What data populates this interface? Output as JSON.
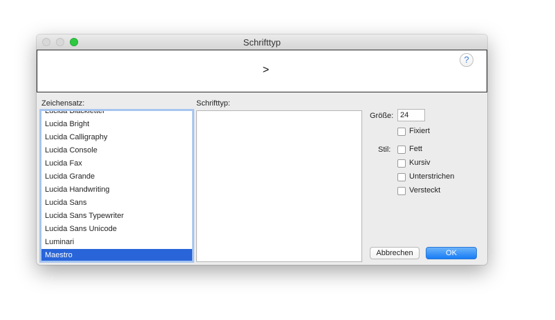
{
  "window": {
    "title": "Schrifttyp"
  },
  "preview": {
    "sample_text": ">",
    "help_label": "?"
  },
  "charset": {
    "label": "Zeichensatz:",
    "items": [
      "Lucida Blackletter",
      "Lucida Bright",
      "Lucida Calligraphy",
      "Lucida Console",
      "Lucida Fax",
      "Lucida Grande",
      "Lucida Handwriting",
      "Lucida Sans",
      "Lucida Sans Typewriter",
      "Lucida Sans Unicode",
      "Luminari",
      "Maestro"
    ],
    "selected": "Maestro"
  },
  "font_type": {
    "label": "Schrifttyp:"
  },
  "size": {
    "label": "Größe:",
    "value": "24",
    "fixed_label": "Fixiert"
  },
  "style": {
    "label": "Stil:",
    "bold": "Fett",
    "italic": "Kursiv",
    "underline": "Unterstrichen",
    "hidden": "Versteckt"
  },
  "buttons": {
    "cancel": "Abbrechen",
    "ok": "OK"
  },
  "colors": {
    "accent": "#2965d9",
    "ok_button": "#177cf5",
    "focus_ring": "#a6c5ef"
  }
}
